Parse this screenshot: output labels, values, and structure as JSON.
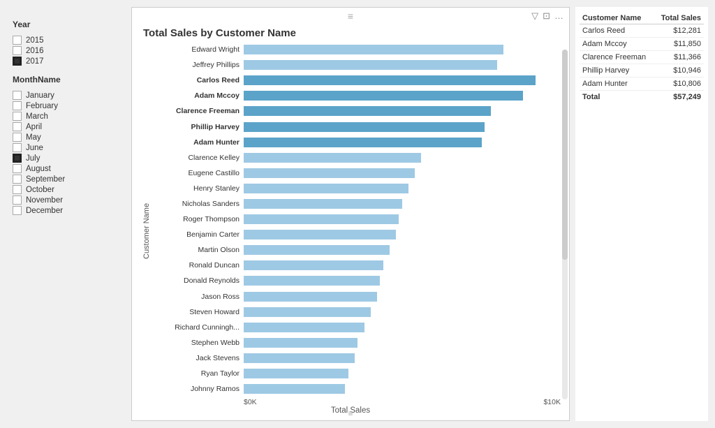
{
  "sidebar": {
    "year_label": "Year",
    "years": [
      {
        "value": "2015",
        "checked": false
      },
      {
        "value": "2016",
        "checked": false
      },
      {
        "value": "2017",
        "checked": true
      }
    ],
    "month_label": "MonthName",
    "months": [
      {
        "value": "January",
        "checked": false
      },
      {
        "value": "February",
        "checked": false
      },
      {
        "value": "March",
        "checked": false
      },
      {
        "value": "April",
        "checked": false
      },
      {
        "value": "May",
        "checked": false
      },
      {
        "value": "June",
        "checked": false
      },
      {
        "value": "July",
        "checked": true
      },
      {
        "value": "August",
        "checked": false
      },
      {
        "value": "September",
        "checked": false
      },
      {
        "value": "October",
        "checked": false
      },
      {
        "value": "November",
        "checked": false
      },
      {
        "value": "December",
        "checked": false
      }
    ]
  },
  "chart": {
    "title": "Total Sales by Customer Name",
    "y_axis_label": "Customer Name",
    "x_axis_label": "Total Sales",
    "x_axis_ticks": [
      "$0K",
      "$10K"
    ],
    "bars": [
      {
        "name": "Edward Wright",
        "bold": false,
        "pct": 82
      },
      {
        "name": "Jeffrey Phillips",
        "bold": false,
        "pct": 80
      },
      {
        "name": "Carlos Reed",
        "bold": true,
        "pct": 92
      },
      {
        "name": "Adam Mccoy",
        "bold": true,
        "pct": 88
      },
      {
        "name": "Clarence Freeman",
        "bold": true,
        "pct": 78
      },
      {
        "name": "Phillip Harvey",
        "bold": true,
        "pct": 76
      },
      {
        "name": "Adam Hunter",
        "bold": true,
        "pct": 75
      },
      {
        "name": "Clarence Kelley",
        "bold": false,
        "pct": 56
      },
      {
        "name": "Eugene Castillo",
        "bold": false,
        "pct": 54
      },
      {
        "name": "Henry Stanley",
        "bold": false,
        "pct": 52
      },
      {
        "name": "Nicholas Sanders",
        "bold": false,
        "pct": 50
      },
      {
        "name": "Roger Thompson",
        "bold": false,
        "pct": 49
      },
      {
        "name": "Benjamin Carter",
        "bold": false,
        "pct": 48
      },
      {
        "name": "Martin Olson",
        "bold": false,
        "pct": 46
      },
      {
        "name": "Ronald Duncan",
        "bold": false,
        "pct": 44
      },
      {
        "name": "Donald Reynolds",
        "bold": false,
        "pct": 43
      },
      {
        "name": "Jason Ross",
        "bold": false,
        "pct": 42
      },
      {
        "name": "Steven Howard",
        "bold": false,
        "pct": 40
      },
      {
        "name": "Richard Cunningh...",
        "bold": false,
        "pct": 38
      },
      {
        "name": "Stephen Webb",
        "bold": false,
        "pct": 36
      },
      {
        "name": "Jack Stevens",
        "bold": false,
        "pct": 35
      },
      {
        "name": "Ryan Taylor",
        "bold": false,
        "pct": 33
      },
      {
        "name": "Johnny Ramos",
        "bold": false,
        "pct": 32
      }
    ]
  },
  "table": {
    "col1": "Customer Name",
    "col2": "Total Sales",
    "rows": [
      {
        "name": "Carlos Reed",
        "value": "$12,281"
      },
      {
        "name": "Adam Mccoy",
        "value": "$11,850"
      },
      {
        "name": "Clarence Freeman",
        "value": "$11,366"
      },
      {
        "name": "Phillip Harvey",
        "value": "$10,946"
      },
      {
        "name": "Adam Hunter",
        "value": "$10,806"
      }
    ],
    "total_label": "Total",
    "total_value": "$57,249"
  },
  "icons": {
    "drag": "≡",
    "filter": "▽",
    "expand": "⊡",
    "more": "…"
  }
}
